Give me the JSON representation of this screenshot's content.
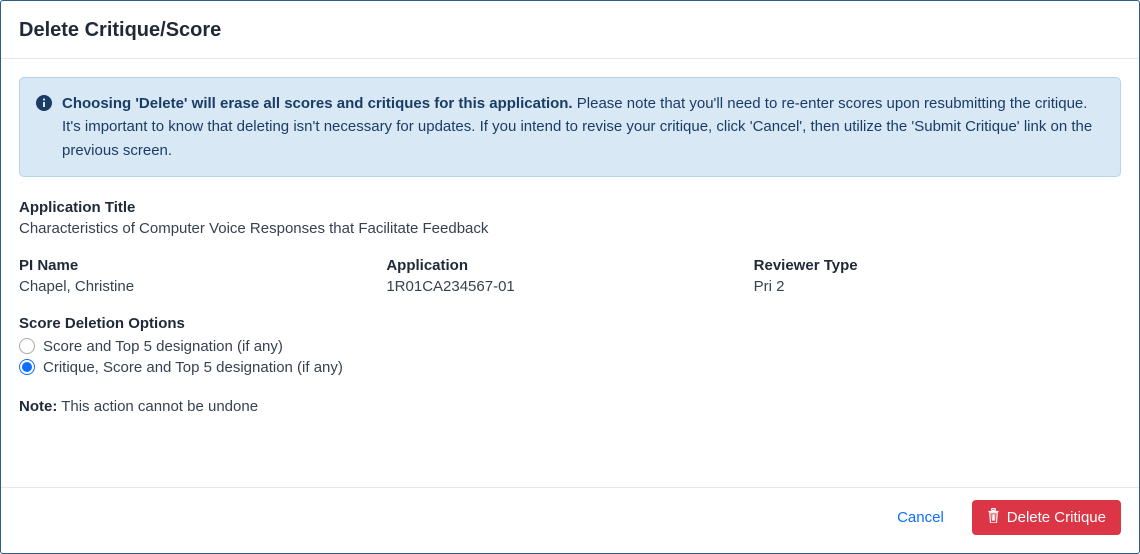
{
  "header": {
    "title": "Delete Critique/Score"
  },
  "alert": {
    "strong": "Choosing 'Delete' will erase all scores and critiques for this application.",
    "rest": " Please note that you'll need to re-enter scores upon resubmitting the critique. It's important to know that deleting isn't necessary for updates. If you intend to revise your critique, click 'Cancel', then utilize the 'Submit Critique' link on the previous screen."
  },
  "app_title": {
    "label": "Application Title",
    "value": "Characteristics of Computer Voice Responses that Facilitate Feedback"
  },
  "pi_name": {
    "label": "PI Name",
    "value": "Chapel, Christine"
  },
  "application": {
    "label": "Application",
    "value": "1R01CA234567-01"
  },
  "reviewer_type": {
    "label": "Reviewer Type",
    "value": "Pri 2"
  },
  "score_deletion": {
    "label": "Score Deletion Options",
    "option1": "Score and Top 5 designation (if any)",
    "option2": "Critique, Score and Top 5 designation (if any)"
  },
  "note": {
    "label": "Note:",
    "text": " This action cannot be undone"
  },
  "footer": {
    "cancel": "Cancel",
    "delete": "Delete Critique"
  }
}
